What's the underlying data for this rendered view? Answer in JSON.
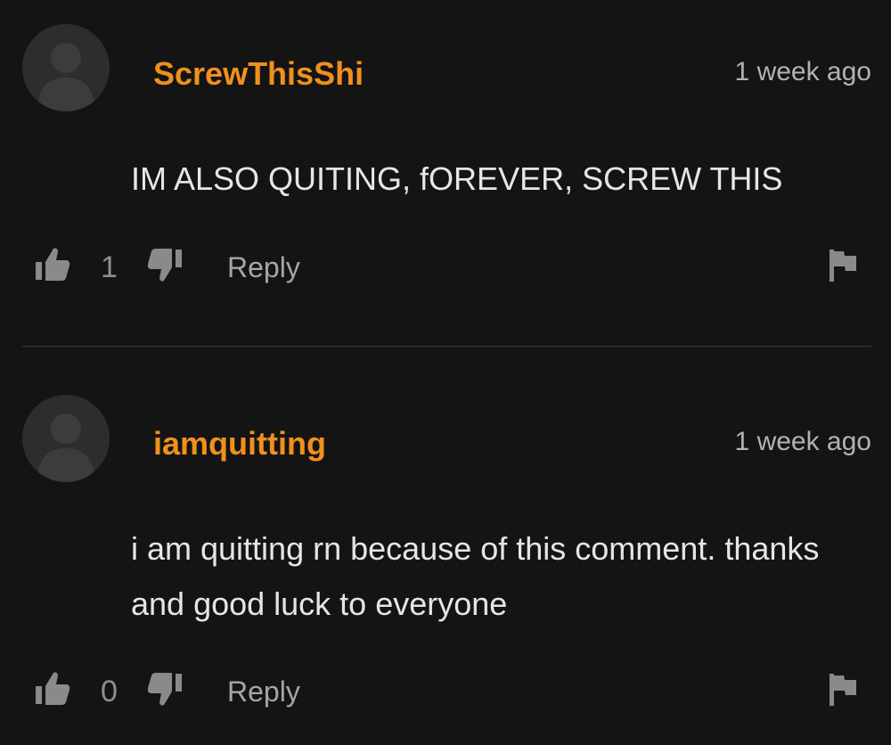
{
  "comments": [
    {
      "username": "ScrewThisShi",
      "time": "1 week ago",
      "text": "IM ALSO QUITING, fOREVER, SCREW THIS",
      "likes": "1",
      "reply_label": "Reply"
    },
    {
      "username": "iamquitting",
      "time": "1 week ago",
      "text": "i am quitting rn because of this comment. thanks and good luck to everyone",
      "likes": "0",
      "reply_label": "Reply"
    }
  ],
  "colors": {
    "background": "#141414",
    "username": "#f0901e",
    "text": "#e6e6e6",
    "muted": "#8f8f8f"
  },
  "icons": [
    "avatar-placeholder-icon",
    "thumbs-up-icon",
    "thumbs-down-icon",
    "flag-icon"
  ]
}
